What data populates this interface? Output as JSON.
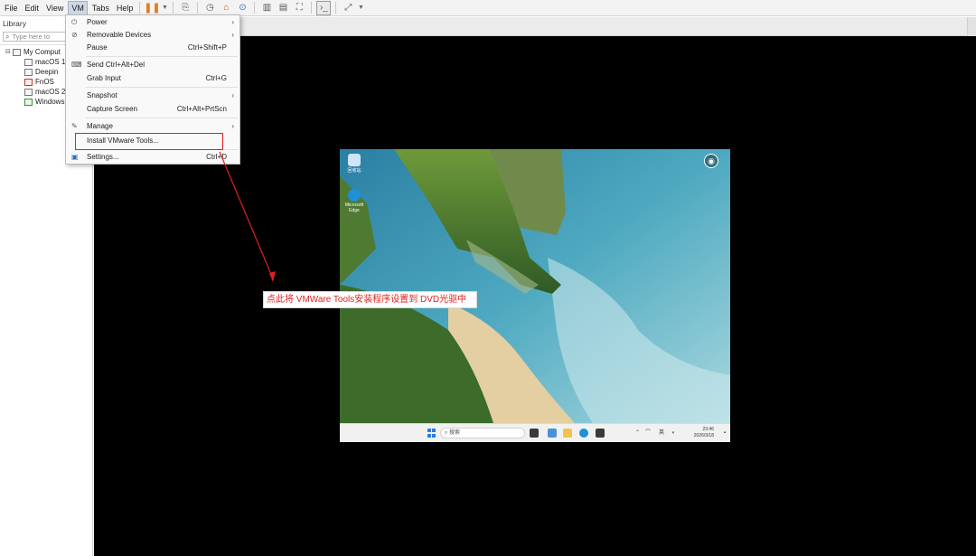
{
  "menubar": {
    "items": [
      "File",
      "Edit",
      "View",
      "VM",
      "Tabs",
      "Help"
    ]
  },
  "toolbar": {
    "icons": [
      "pause-icon",
      "send-ctrl-alt-del-icon",
      "snapshot-icon",
      "revert-snapshot-icon",
      "manage-snapshots-icon",
      "library-view-icon",
      "thumbnail-view-icon",
      "fullscreen-icon",
      "console-icon",
      "unity-icon"
    ]
  },
  "library": {
    "title": "Library",
    "search_placeholder": "Type here to",
    "root": "My Comput",
    "vms": [
      "macOS 1",
      "Deepin",
      "FnOS",
      "macOS 2",
      "Windows"
    ]
  },
  "vm_menu": {
    "items": [
      {
        "label": "Power",
        "shortcut": "",
        "submenu": true,
        "icon": "power-icon"
      },
      {
        "label": "Removable Devices",
        "shortcut": "",
        "submenu": true,
        "icon": "no-device-icon"
      },
      {
        "label": "Pause",
        "shortcut": "Ctrl+Shift+P",
        "submenu": false,
        "icon": ""
      },
      {
        "label": "Send Ctrl+Alt+Del",
        "shortcut": "",
        "submenu": false,
        "icon": "keyboard-icon"
      },
      {
        "label": "Grab Input",
        "shortcut": "Ctrl+G",
        "submenu": false,
        "icon": ""
      },
      {
        "label": "Snapshot",
        "shortcut": "",
        "submenu": true,
        "icon": ""
      },
      {
        "label": "Capture Screen",
        "shortcut": "Ctrl+Alt+PrtScn",
        "submenu": false,
        "icon": ""
      },
      {
        "label": "Manage",
        "shortcut": "",
        "submenu": true,
        "icon": "wrench-icon"
      },
      {
        "label": "Install VMware Tools...",
        "shortcut": "",
        "submenu": false,
        "icon": ""
      },
      {
        "label": "Settings...",
        "shortcut": "Ctrl+D",
        "submenu": false,
        "icon": "settings-icon"
      }
    ]
  },
  "annotation": {
    "callout_text": "点此将 VMWare Tools安装程序设置到 DVD光驱中",
    "color": "#e02020"
  },
  "guest": {
    "desktop_icons": [
      "回收站",
      "Microsoft Edge"
    ],
    "taskbar": {
      "search_label": "搜索",
      "tray_lang": "英",
      "time": "23:46",
      "date": "2026/3/18"
    }
  }
}
